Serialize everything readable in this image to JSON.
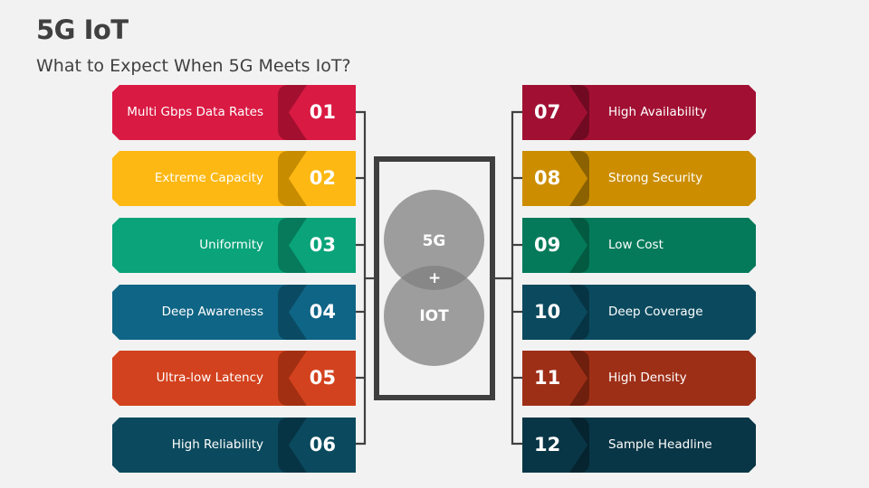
{
  "header": {
    "title": "5G IoT",
    "subtitle": "What to Expect When 5G Meets IoT?"
  },
  "center": {
    "top_circle": "5G",
    "bottom_circle": "IOT",
    "join_symbol": "+"
  },
  "left_items": [
    {
      "number": "01",
      "label": "Multi Gbps Data Rates",
      "color": "#d91a43",
      "dark": "#a3102f"
    },
    {
      "number": "02",
      "label": "Extreme Capacity",
      "color": "#fdb813",
      "dark": "#c88c00"
    },
    {
      "number": "03",
      "label": "Uniformity",
      "color": "#0aa37a",
      "dark": "#067a5a"
    },
    {
      "number": "04",
      "label": "Deep Awareness",
      "color": "#0f6585",
      "dark": "#0a4a63"
    },
    {
      "number": "05",
      "label": "Ultra-low Latency",
      "color": "#d3421e",
      "dark": "#a32f12"
    },
    {
      "number": "06",
      "label": "High Reliability",
      "color": "#0b4a5e",
      "dark": "#073444"
    }
  ],
  "right_items": [
    {
      "number": "07",
      "label": "High Availability",
      "color": "#a11033",
      "dark": "#6f0a22"
    },
    {
      "number": "08",
      "label": "Strong Security",
      "color": "#cc8e00",
      "dark": "#8c6200"
    },
    {
      "number": "09",
      "label": "Low Cost",
      "color": "#047a5a",
      "dark": "#035a41"
    },
    {
      "number": "10",
      "label": "Deep Coverage",
      "color": "#0b4a5e",
      "dark": "#073444"
    },
    {
      "number": "11",
      "label": "High Density",
      "color": "#9e2f17",
      "dark": "#6e1f0d"
    },
    {
      "number": "12",
      "label": "Sample Headline",
      "color": "#093646",
      "dark": "#052430"
    }
  ]
}
